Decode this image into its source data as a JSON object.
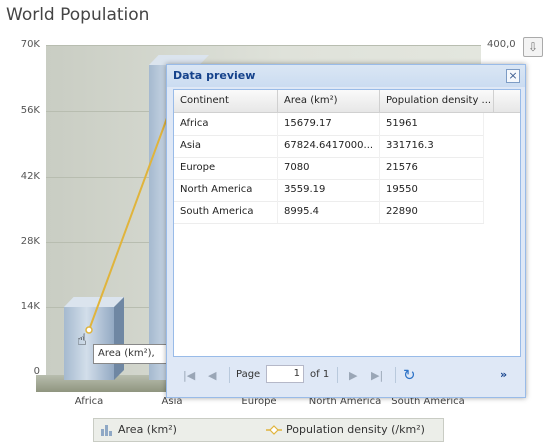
{
  "chart": {
    "title": "World Population",
    "left_axis_ticks": [
      "70K",
      "56K",
      "42K",
      "28K",
      "14K",
      "0"
    ],
    "right_axis_top_label": "400,0",
    "categories": [
      "Africa",
      "Asia",
      "Europe",
      "North America",
      "South America"
    ],
    "tooltip_text": "Area (km²),",
    "colors": {
      "bar": "#a5b9cf",
      "line": "#e0b43c",
      "plot_bg": "#dfe2da"
    }
  },
  "chart_data": {
    "type": "bar",
    "title": "World Population",
    "categories": [
      "Africa",
      "Asia",
      "Europe",
      "North America",
      "South America"
    ],
    "ylim": [
      0,
      70000
    ],
    "series": [
      {
        "name": "Area (km²)",
        "values": [
          15679.17,
          67824.6417,
          7080,
          3559.19,
          8995.4
        ]
      },
      {
        "name": "Population density (/km²)",
        "values": [
          51961,
          331716.3,
          21576,
          19550,
          22890
        ]
      }
    ]
  },
  "legend": {
    "items": [
      {
        "label": "Area (km²)",
        "icon": "bar-chart-icon"
      },
      {
        "label": "Population density (/km²)",
        "icon": "line-marker-icon"
      }
    ]
  },
  "dialog": {
    "title": "Data preview",
    "close_icon": "close-icon",
    "columns": [
      "Continent",
      "Area (km²)",
      "Population density ..."
    ],
    "rows": [
      [
        "Africa",
        "15679.17",
        "51961"
      ],
      [
        "Asia",
        "67824.6417000...",
        "331716.3"
      ],
      [
        "Europe",
        "7080",
        "21576"
      ],
      [
        "North America",
        "3559.19",
        "19550"
      ],
      [
        "South America",
        "8995.4",
        "22890"
      ]
    ],
    "pager": {
      "page_label": "Page",
      "page_value": "1",
      "of_label": "of 1"
    }
  }
}
